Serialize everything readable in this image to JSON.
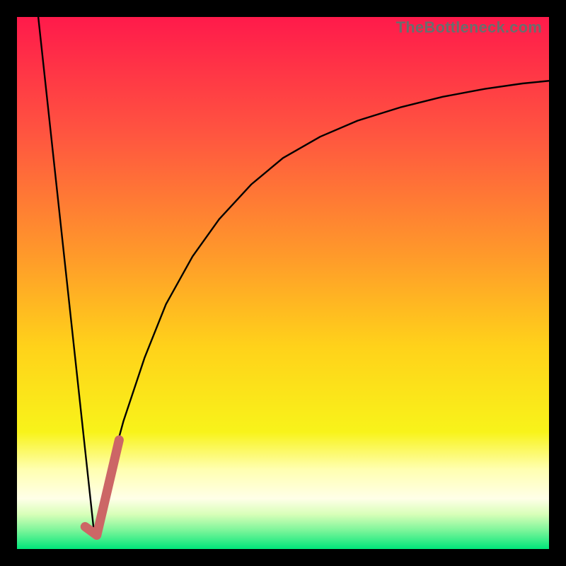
{
  "watermark": "TheBottleneck.com",
  "chart_data": {
    "type": "line",
    "title": "",
    "xlabel": "",
    "ylabel": "",
    "xlim": [
      0,
      100
    ],
    "ylim": [
      0,
      100
    ],
    "grid": false,
    "legend": false,
    "gradient_stops": [
      {
        "offset": 0.0,
        "color": "#ff1a4b"
      },
      {
        "offset": 0.22,
        "color": "#ff5540"
      },
      {
        "offset": 0.45,
        "color": "#ff9a2a"
      },
      {
        "offset": 0.62,
        "color": "#ffd21a"
      },
      {
        "offset": 0.78,
        "color": "#f8f31a"
      },
      {
        "offset": 0.85,
        "color": "#ffffb0"
      },
      {
        "offset": 0.905,
        "color": "#ffffe8"
      },
      {
        "offset": 0.935,
        "color": "#d8ffb8"
      },
      {
        "offset": 0.965,
        "color": "#7cf59a"
      },
      {
        "offset": 1.0,
        "color": "#00e67a"
      }
    ],
    "series": [
      {
        "name": "v-left",
        "stroke": "#000000",
        "stroke_width": 2.4,
        "x": [
          4.0,
          14.5
        ],
        "y": [
          100,
          3
        ]
      },
      {
        "name": "curve-right",
        "stroke": "#000000",
        "stroke_width": 2.4,
        "x": [
          14.5,
          17,
          20,
          24,
          28,
          33,
          38,
          44,
          50,
          57,
          64,
          72,
          80,
          88,
          95,
          100
        ],
        "y": [
          3,
          13,
          24,
          36,
          46,
          55,
          62,
          68.5,
          73.5,
          77.5,
          80.5,
          83,
          85,
          86.5,
          87.5,
          88
        ]
      },
      {
        "name": "highlight-tick",
        "stroke": "#cc6666",
        "stroke_width": 13,
        "linecap": "round",
        "x": [
          12.8,
          15.0,
          19.2
        ],
        "y": [
          4.2,
          2.6,
          20.5
        ]
      }
    ]
  }
}
